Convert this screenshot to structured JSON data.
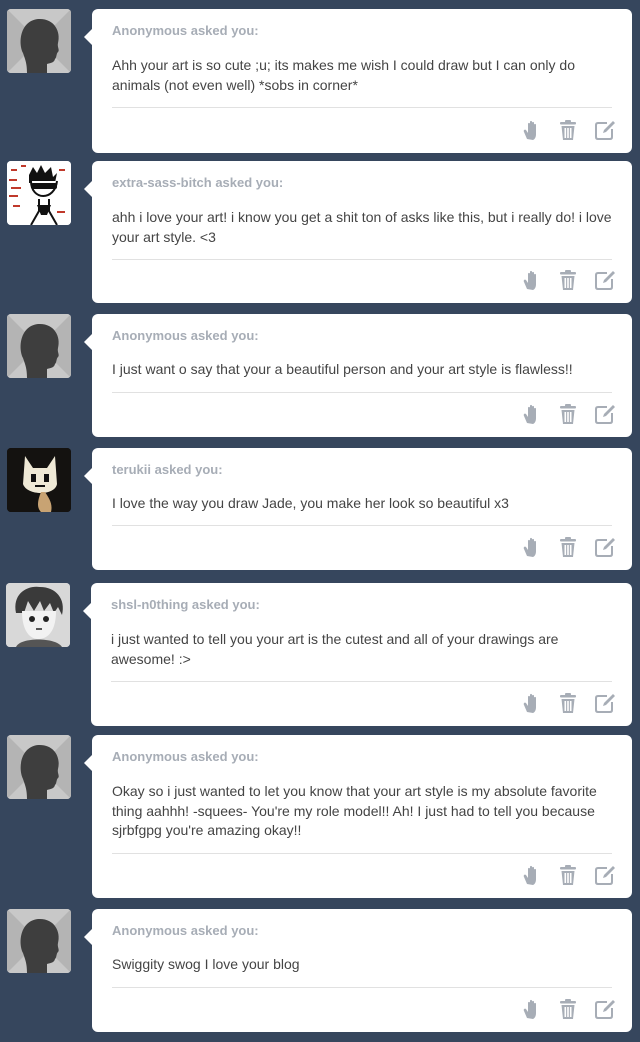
{
  "asks": [
    {
      "asker": "Anonymous asked you:",
      "question": "Ahh your art is so cute ;u; its makes me wish I could draw but I can only do animals (not even well) *sobs in corner*",
      "avatar": "anonymous-avatar"
    },
    {
      "asker": "extra-sass-bitch asked you:",
      "question": "ahh i love your art! i know you get a shit ton of asks like this, but i really do! i love your art style. <3",
      "avatar": "user-avatar"
    },
    {
      "asker": "Anonymous asked you:",
      "question": "I just want o say that your a beautiful person and your art style is flawless!!",
      "avatar": "anonymous-avatar"
    },
    {
      "asker": "terukii asked you:",
      "question": "I love the way you draw Jade, you make her look so beautiful x3",
      "avatar": "user-avatar"
    },
    {
      "asker": "shsl-n0thing asked you:",
      "question": "i just wanted to tell you your art is the cutest and all of your drawings are awesome! :>",
      "avatar": "user-avatar"
    },
    {
      "asker": "Anonymous asked you:",
      "question": "Okay so i just wanted to let you know that your art style is my absolute favorite thing aahhh! -squees- You're my role model!! Ah! I just had to tell you because sjrbfgpg you're amazing okay!!",
      "avatar": "anonymous-avatar"
    },
    {
      "asker": "Anonymous asked you:",
      "question": "Swiggity swog I love your blog",
      "avatar": "anonymous-avatar"
    }
  ],
  "action_icons": [
    "block-hand-icon",
    "trash-icon",
    "edit-icon"
  ],
  "colors": {
    "background": "#36465d",
    "card": "#ffffff",
    "asker": "#a7adb6",
    "text": "#444444",
    "icon": "#a7adb6"
  }
}
